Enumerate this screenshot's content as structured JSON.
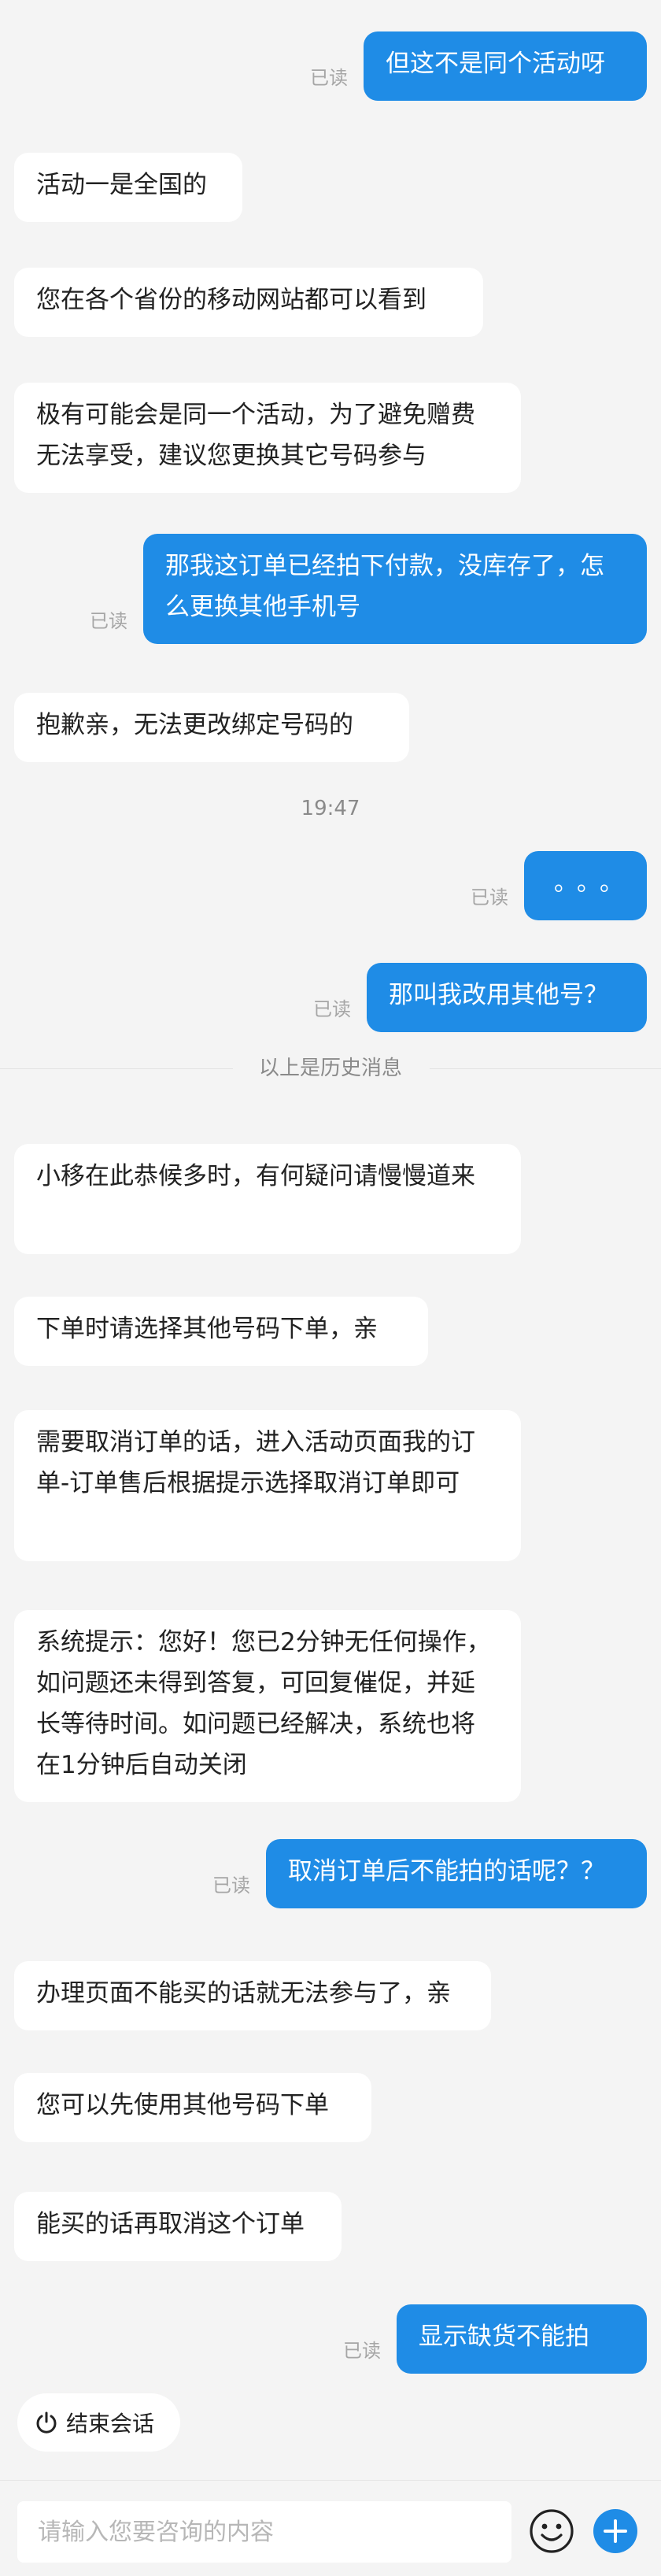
{
  "messages": [
    {
      "dir": "out",
      "text": "但这不是同个活动呀",
      "read": "已读"
    },
    {
      "dir": "in",
      "text": "活动一是全国的"
    },
    {
      "dir": "in",
      "text": "您在各个省份的移动网站都可以看到"
    },
    {
      "dir": "in",
      "text": "极有可能会是同一个活动，为了避免赠费无法享受，建议您更换其它号码参与"
    },
    {
      "dir": "out",
      "text": "那我这订单已经拍下付款，没库存了，怎么更换其他手机号",
      "read": "已读"
    },
    {
      "dir": "in",
      "text": "抱歉亲，无法更改绑定号码的"
    },
    {
      "type": "time",
      "text": "19:47"
    },
    {
      "dir": "out",
      "text": "。。。",
      "read": "已读"
    },
    {
      "dir": "out",
      "text": "那叫我改用其他号？",
      "read": "已读"
    },
    {
      "type": "divider",
      "text": "以上是历史消息"
    },
    {
      "dir": "in",
      "text": "小移在此恭候多时，有何疑问请慢慢道来"
    },
    {
      "dir": "in",
      "text": "下单时请选择其他号码下单，亲"
    },
    {
      "dir": "in",
      "text": "需要取消订单的话，进入活动页面我的订单-订单售后根据提示选择取消订单即可"
    },
    {
      "dir": "in",
      "text": "系统提示：您好！您已2分钟无任何操作，如问题还未得到答复，可回复催促，并延长等待时间。如问题已经解决，系统也将在1分钟后自动关闭"
    },
    {
      "dir": "out",
      "text": "取消订单后不能拍的话呢？？",
      "read": "已读"
    },
    {
      "dir": "in",
      "text": "办理页面不能买的话就无法参与了，亲"
    },
    {
      "dir": "in",
      "text": "您可以先使用其他号码下单"
    },
    {
      "dir": "in",
      "text": "能买的话再取消这个订单"
    },
    {
      "dir": "out",
      "text": "显示缺货不能拍",
      "read": "已读"
    }
  ],
  "end_session": {
    "label": "结束会话",
    "icon": "power-icon"
  },
  "composer": {
    "placeholder": "请输入您要咨询的内容",
    "emoji_icon": "smiley-icon",
    "plus_icon": "plus-icon"
  },
  "colors": {
    "accent": "#1f8ce6",
    "background": "#f4f4f4",
    "bubble_in": "#ffffff"
  }
}
